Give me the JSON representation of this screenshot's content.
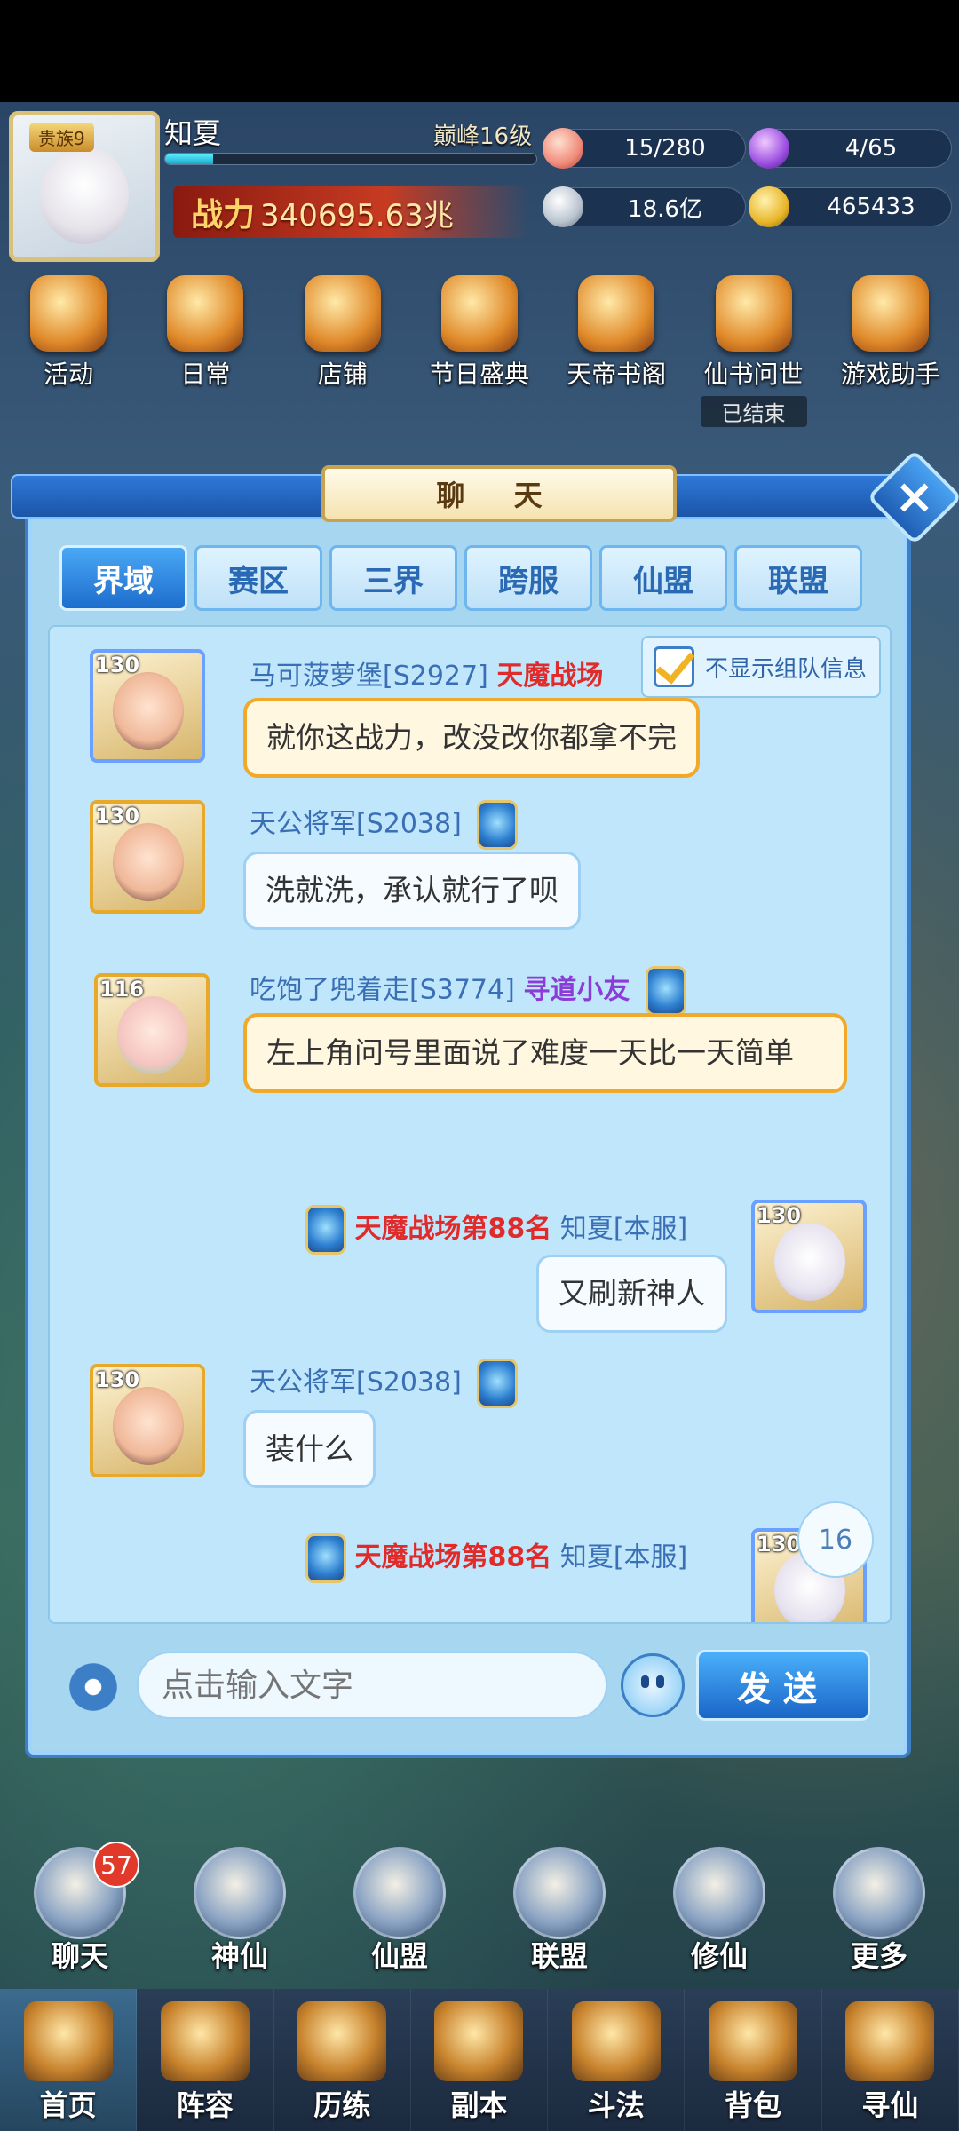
{
  "hud": {
    "noble_badge": "贵族9",
    "player_name": "知夏",
    "rank": "巅峰16级",
    "exp_fraction": 0.13,
    "power_label": "战力",
    "power_value": "340695.63兆",
    "resources": [
      {
        "icon": "peach-icon",
        "value": "15/280"
      },
      {
        "icon": "purple-flame-icon",
        "value": "4/65"
      },
      {
        "icon": "silver-coin-icon",
        "value": "18.6亿"
      },
      {
        "icon": "gold-ingot-icon",
        "value": "465433"
      }
    ]
  },
  "features": [
    {
      "label": "活动",
      "icon": "activity-icon"
    },
    {
      "label": "日常",
      "icon": "daily-icon"
    },
    {
      "label": "店铺",
      "icon": "shop-icon"
    },
    {
      "label": "节日盛典",
      "icon": "festival-gift-icon"
    },
    {
      "label": "天帝书阁",
      "icon": "book-pavilion-icon"
    },
    {
      "label": "仙书问世",
      "icon": "immortal-book-icon",
      "sub": "已结束"
    },
    {
      "label": "游戏助手",
      "icon": "game-assistant-icon"
    }
  ],
  "chat": {
    "title": "聊 天",
    "tabs": [
      {
        "label": "界域",
        "active": true
      },
      {
        "label": "赛区",
        "active": false
      },
      {
        "label": "三界",
        "active": false
      },
      {
        "label": "跨服",
        "active": false
      },
      {
        "label": "仙盟",
        "active": false
      },
      {
        "label": "联盟",
        "active": false
      }
    ],
    "hide_team_label": "不显示组队信息",
    "messages": [
      {
        "level": "130",
        "name": "马可菠萝堡[S2927]",
        "title": "天魔战场",
        "text": "就你这战力，改没改你都拿不完",
        "style": "gold"
      },
      {
        "level": "130",
        "name": "天公将军[S2038]",
        "text": "洗就洗，承认就行了呗"
      },
      {
        "level": "116",
        "name": "吃饱了兜着走[S3774]",
        "title": "寻道小友",
        "text": "左上角问号里面说了难度一天比一天简单",
        "style": "gold"
      },
      {
        "level": "130",
        "name": "知夏[本服]",
        "title": "天魔战场第88名",
        "text": "又刷新神人",
        "self": true
      },
      {
        "level": "130",
        "name": "天公将军[S2038]",
        "text": "装什么"
      },
      {
        "level": "130",
        "name": "知夏[本服]",
        "title": "天魔战场第88名",
        "text": "",
        "self": true
      }
    ],
    "unread_count": "16",
    "input_placeholder": "点击输入文字",
    "send_label": "发送"
  },
  "menu": [
    {
      "label": "聊天",
      "icon": "chat-icon",
      "badge": "57"
    },
    {
      "label": "神仙",
      "icon": "immortal-icon"
    },
    {
      "label": "仙盟",
      "icon": "guild-icon"
    },
    {
      "label": "联盟",
      "icon": "alliance-icon"
    },
    {
      "label": "修仙",
      "icon": "crane-icon"
    },
    {
      "label": "更多",
      "icon": "more-icon"
    }
  ],
  "nav": [
    {
      "label": "首页",
      "icon": "home-icon",
      "active": true
    },
    {
      "label": "阵容",
      "icon": "lineup-icon"
    },
    {
      "label": "历练",
      "icon": "training-icon"
    },
    {
      "label": "副本",
      "icon": "dungeon-icon"
    },
    {
      "label": "斗法",
      "icon": "battle-icon"
    },
    {
      "label": "背包",
      "icon": "backpack-icon"
    },
    {
      "label": "寻仙",
      "icon": "seek-immortal-icon"
    }
  ]
}
